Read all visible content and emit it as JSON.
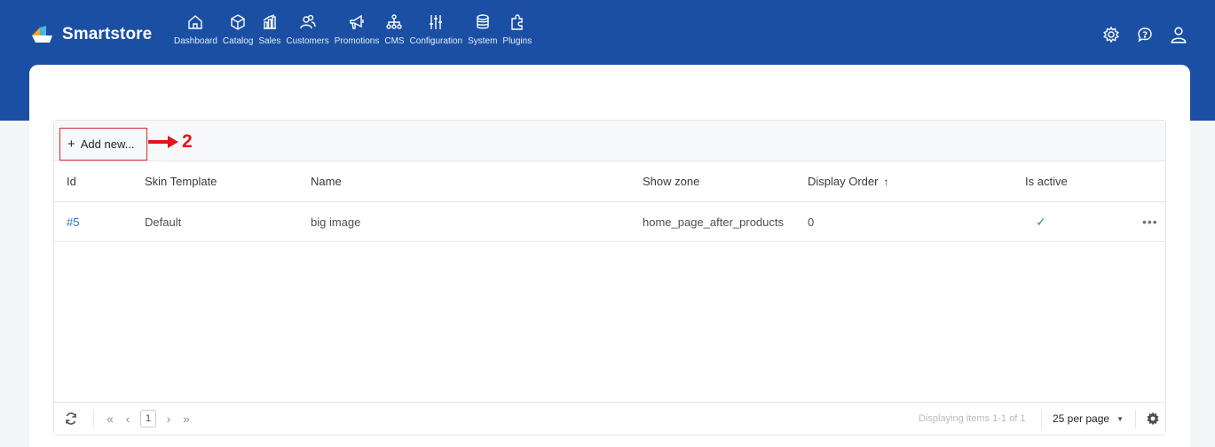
{
  "brand": {
    "name": "Smartstore",
    "logo_colors": [
      "#f7a81b",
      "#4fb3e8",
      "#ffffff"
    ]
  },
  "nav": {
    "items": [
      {
        "label": "Dashboard",
        "icon": "home-icon"
      },
      {
        "label": "Catalog",
        "icon": "box-icon"
      },
      {
        "label": "Sales",
        "icon": "bar-chart-icon"
      },
      {
        "label": "Customers",
        "icon": "users-icon"
      },
      {
        "label": "Promotions",
        "icon": "megaphone-icon"
      },
      {
        "label": "CMS",
        "icon": "sitemap-icon"
      },
      {
        "label": "Configuration",
        "icon": "sliders-icon"
      },
      {
        "label": "System",
        "icon": "database-icon"
      },
      {
        "label": "Plugins",
        "icon": "puzzle-icon"
      }
    ]
  },
  "top_actions": [
    "settings-icon",
    "help-icon",
    "user-icon"
  ],
  "toolbar": {
    "add_label": "Add new..."
  },
  "annotation": {
    "number": "2",
    "color": "#e3131b"
  },
  "table": {
    "columns": [
      "Id",
      "Skin Template",
      "Name",
      "Show zone",
      "Display Order",
      "Is active"
    ],
    "sort_column": "Display Order",
    "sort_direction": "ascending",
    "rows": [
      {
        "id": "#5",
        "skin_template": "Default",
        "name": "big image",
        "show_zone": "home_page_after_products",
        "display_order": "0",
        "is_active": true
      }
    ]
  },
  "footer": {
    "current_page": "1",
    "info": "Displaying items 1-1 of 1",
    "per_page": "25 per page"
  },
  "colors": {
    "topbar": "#1a4fa3",
    "link": "#2f6cc7",
    "active_check": "#2ea44f"
  }
}
